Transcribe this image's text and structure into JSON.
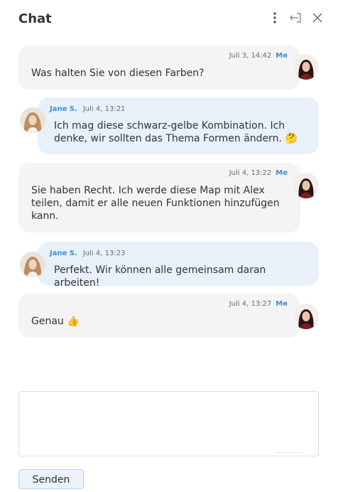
{
  "header": {
    "title": "Chat"
  },
  "messages": [
    {
      "id": "m1",
      "from": "me",
      "sender": "Me",
      "time": "Juli 3, 14:42",
      "text": "Was halten Sie von diesen Farben?",
      "emoji": ""
    },
    {
      "id": "m2",
      "from": "other",
      "sender": "Jane S.",
      "time": "Juli 4, 13:21",
      "text": "Ich mag diese schwarz-gelbe Kombination. Ich denke, wir sollten das Thema Formen ändern.",
      "emoji": "🤔"
    },
    {
      "id": "m3",
      "from": "me",
      "sender": "Me",
      "time": "Juli 4, 13:22",
      "text": "Sie haben Recht. Ich werde diese Map mit Alex teilen, damit er alle neuen Funktionen hinzufügen kann.",
      "emoji": ""
    },
    {
      "id": "m4",
      "from": "other",
      "sender": "Jane S.",
      "time": "Juli 4, 13:23",
      "text": "Perfekt. Wir können alle gemeinsam daran arbeiten!",
      "emoji": ""
    },
    {
      "id": "m5",
      "from": "me",
      "sender": "Me",
      "time": "Juli 4, 13:27",
      "text": "Genau",
      "emoji": "👍"
    }
  ],
  "composer": {
    "value": "",
    "placeholder": ""
  },
  "send_label": "Senden",
  "icons": {
    "more": "more-vertical-icon",
    "collapse": "collapse-panel-icon",
    "close": "close-icon"
  },
  "colors": {
    "me_bubble": "#f4f3f5",
    "other_bubble": "#e8f1fa",
    "sender_name": "#3f8fd8",
    "send_button": "#eaf3fb"
  }
}
